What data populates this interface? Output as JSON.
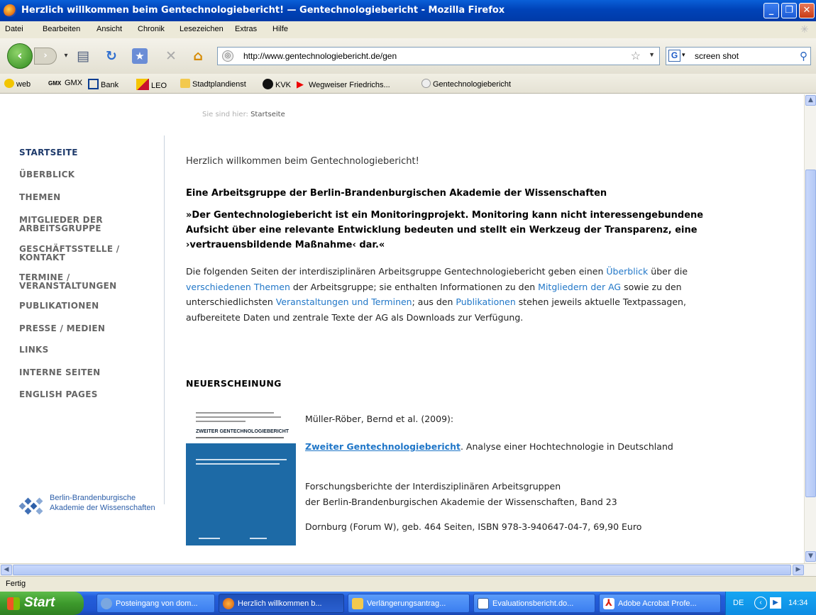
{
  "window": {
    "title": "Herzlich willkommen beim Gentechnologiebericht! — Gentechnologiebericht - Mozilla Firefox"
  },
  "menu": [
    "Datei",
    "Bearbeiten",
    "Ansicht",
    "Chronik",
    "Lesezeichen",
    "Extras",
    "Hilfe"
  ],
  "navbar": {
    "url": "http://www.gentechnologiebericht.de/gen",
    "search_value": "screen shot"
  },
  "bookmarks": [
    "web",
    "GMX",
    "Bank",
    "LEO",
    "Stadtplandienst",
    "KVK",
    "Wegweiser Friedrichs...",
    "Gentechnologiebericht"
  ],
  "page": {
    "breadcrumb_label": "Sie sind hier:",
    "breadcrumb_value": "Startseite",
    "nav": [
      "STARTSEITE",
      "ÜBERBLICK",
      "THEMEN",
      "MITGLIEDER DER\nARBEITSGRUPPE",
      "GESCHÄFTSSTELLE /\nKONTAKT",
      "TERMINE /\nVERANSTALTUNGEN",
      "PUBLIKATIONEN",
      "PRESSE / MEDIEN",
      "LINKS",
      "INTERNE SEITEN",
      "ENGLISH PAGES"
    ],
    "logo_line1": "Berlin-Brandenburgische",
    "logo_line2": "Akademie der Wissenschaften",
    "welcome": "Herzlich willkommen beim Gentechnologiebericht!",
    "subheading": "Eine Arbeitsgruppe der Berlin-Brandenburgischen Akademie der Wissenschaften",
    "quote": "»Der Gentechnologiebericht ist ein Monitoringprojekt. Monitoring kann nicht interessengebundene Aufsicht über eine relevante Entwicklung bedeuten und stellt ein Werkzeug der Transparenz, eine ›vertrauensbildende Maßnahme‹ dar.«",
    "para": {
      "t1": "Die folgenden Seiten der interdisziplinären Arbeitsgruppe Gentechnologiebericht geben einen ",
      "l1": "Überblick",
      "t2": " über die ",
      "l2": "verschiedenen Themen",
      "t3": " der Arbeitsgruppe; sie enthalten Informationen zu den ",
      "l3": "Mitgliedern der AG",
      "t4": " sowie zu den unterschiedlichsten ",
      "l4": "Veranstaltungen und Terminen",
      "t5": "; aus den ",
      "l5": "Publikationen",
      "t6": " stehen jeweils aktuelle Textpassagen, aufbereitete Daten und zentrale Texte der AG als Downloads zur Verfügung."
    },
    "neu_heading": "NEUERSCHEINUNG",
    "book": {
      "cover_title": "ZWEITER GENTECHNOLOGIEBERICHT",
      "authors": "Müller-Röber, Bernd et al. (2009):",
      "title_link": "Zweiter Gentechnologiebericht",
      "title_rest": ". Analyse einer Hochtechnologie in Deutschland",
      "series1": "Forschungsberichte der Interdisziplinären Arbeitsgruppen",
      "series2": "der Berlin-Brandenburgischen Akademie der Wissenschaften, Band 23",
      "pub": "Dornburg (Forum W), geb. 464 Seiten, ISBN 978-3-940647-04-7, 69,90 Euro"
    }
  },
  "status": "Fertig",
  "taskbar": {
    "start": "Start",
    "tasks": [
      "Posteingang von dom...",
      "Herzlich willkommen b...",
      "Verlängerungsantrag...",
      "Evaluationsbericht.do...",
      "Adobe Acrobat Profe..."
    ],
    "lang": "DE",
    "time": "14:34"
  }
}
